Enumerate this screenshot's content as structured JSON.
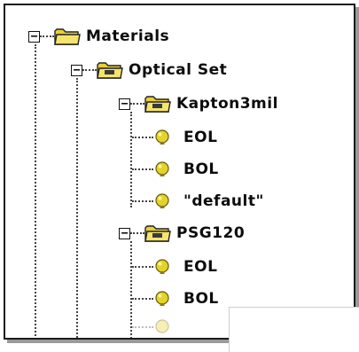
{
  "tree": {
    "root": {
      "label": "Materials",
      "icon": "folder-icon",
      "expander": "⊟"
    },
    "optical_set": {
      "label": "Optical Set",
      "icon": "folder-icon",
      "expander": "⊟"
    },
    "kapton": {
      "label": "Kapton3mil",
      "icon": "folder-icon",
      "expander": "⊟",
      "children": [
        "EOL",
        "BOL",
        "\"default\""
      ]
    },
    "psg": {
      "label": "PSG120",
      "icon": "folder-icon",
      "expander": "⊟",
      "children": [
        "EOL",
        "BOL"
      ]
    }
  },
  "colors": {
    "folder": "#e8cf3a",
    "bulb": "#e3d32a",
    "line": "#444444"
  }
}
